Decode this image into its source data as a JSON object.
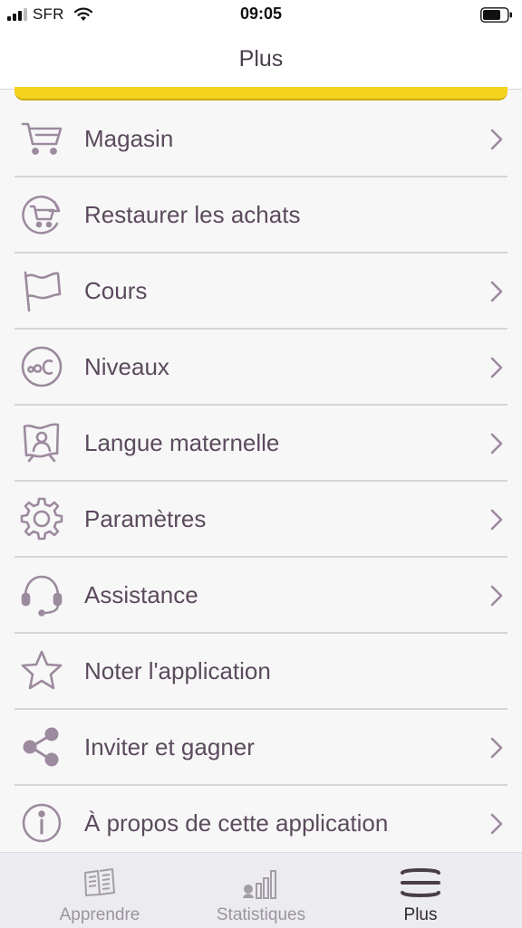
{
  "status_bar": {
    "carrier": "SFR",
    "time": "09:05"
  },
  "header": {
    "title": "Plus"
  },
  "menu": {
    "items": [
      {
        "label": "Magasin",
        "icon": "cart-icon",
        "has_chevron": true
      },
      {
        "label": "Restaurer les achats",
        "icon": "restore-purchases-icon",
        "has_chevron": false
      },
      {
        "label": "Cours",
        "icon": "flag-icon",
        "has_chevron": true
      },
      {
        "label": "Niveaux",
        "icon": "levels-icon",
        "has_chevron": true
      },
      {
        "label": "Langue maternelle",
        "icon": "native-language-icon",
        "has_chevron": true
      },
      {
        "label": "Paramètres",
        "icon": "gear-icon",
        "has_chevron": true
      },
      {
        "label": "Assistance",
        "icon": "headset-icon",
        "has_chevron": true
      },
      {
        "label": "Noter l'application",
        "icon": "star-icon",
        "has_chevron": false
      },
      {
        "label": "Inviter et gagner",
        "icon": "share-icon",
        "has_chevron": true
      },
      {
        "label": "À propos de cette application",
        "icon": "info-icon",
        "has_chevron": true
      }
    ]
  },
  "tab_bar": {
    "tabs": [
      {
        "label": "Apprendre",
        "icon": "book-icon",
        "active": false
      },
      {
        "label": "Statistiques",
        "icon": "stats-icon",
        "active": false
      },
      {
        "label": "Plus",
        "icon": "menu-icon",
        "active": true
      }
    ]
  },
  "colors": {
    "accent_text": "#5b4a5d",
    "icon": "#9c8a9e",
    "banner": "#f5d21c"
  }
}
